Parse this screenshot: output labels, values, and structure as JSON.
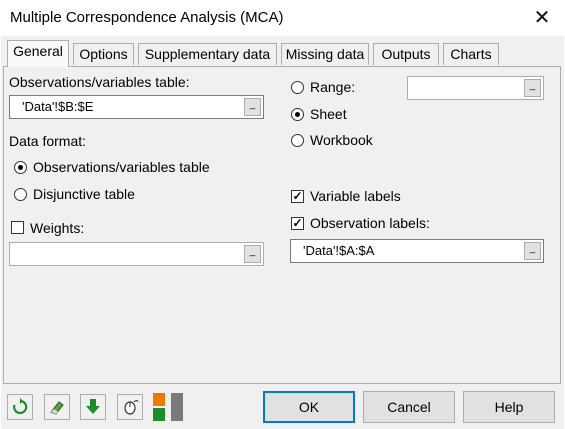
{
  "window": {
    "title": "Multiple Correspondence Analysis (MCA)",
    "close_glyph": "✕"
  },
  "tabs": [
    {
      "label": "General",
      "active": true
    },
    {
      "label": "Options",
      "active": false
    },
    {
      "label": "Supplementary data",
      "active": false
    },
    {
      "label": "Missing data",
      "active": false
    },
    {
      "label": "Outputs",
      "active": false
    },
    {
      "label": "Charts",
      "active": false
    }
  ],
  "general": {
    "obs_table_label": "Observations/variables table:",
    "obs_table_value": "'Data'!$B:$E",
    "data_format_label": "Data format:",
    "format_obs_label": "Observations/variables table",
    "format_disj_label": "Disjunctive table",
    "weights_label": "Weights:",
    "weights_value": "",
    "range_label": "Range:",
    "range_value": "",
    "sheet_label": "Sheet",
    "workbook_label": "Workbook",
    "variable_labels_label": "Variable labels",
    "observation_labels_label": "Observation labels:",
    "observation_labels_value": "'Data'!$A:$A",
    "picker_glyph": "_",
    "selected_format": "Observations/variables table",
    "selected_output": "Sheet",
    "variable_labels_checked": true,
    "observation_labels_checked": true,
    "weights_checked": false
  },
  "footer": {
    "ok_label": "OK",
    "cancel_label": "Cancel",
    "help_label": "Help",
    "icons": [
      "reset-icon",
      "eraser-icon",
      "download-arrow-icon",
      "mouse-icon",
      "color-swatch-icon"
    ]
  },
  "colors": {
    "green": "#1f8c2a",
    "orange": "#f07800",
    "accent": "#0078d7"
  }
}
